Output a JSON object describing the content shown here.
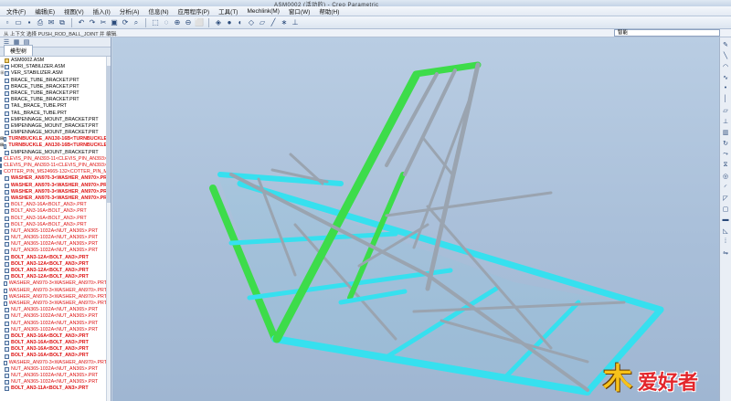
{
  "window": {
    "title": "ASM0002 (活动的) - Creo Parametric"
  },
  "menu": [
    "文件(F)",
    "编辑(E)",
    "视图(V)",
    "插入(I)",
    "分析(A)",
    "信息(N)",
    "应用程序(P)",
    "工具(T)",
    "Mechlink(M)",
    "窗口(W)",
    "帮助(H)"
  ],
  "toolbar": {
    "icons": [
      "new-icon",
      "open-icon",
      "save-icon",
      "print-icon",
      "email-icon",
      "copy-icon",
      "undo-icon",
      "redo-icon",
      "cut-icon",
      "paste-icon",
      "regenerate-icon",
      "find-icon",
      "select-icon",
      "repaint-icon",
      "zoom-in-icon",
      "zoom-out-icon",
      "refit-icon",
      "orient-icon",
      "shading-icon",
      "hidden-line-icon",
      "wireframe-icon",
      "datum-plane-icon",
      "datum-axis-icon",
      "datum-point-icon",
      "csys-icon"
    ]
  },
  "status": {
    "message": "从 上下文 选择 PUSH_ROD_BALL_JOINT 并 编辑.",
    "filter_value": "智能"
  },
  "model_tree": {
    "tab": "模型树",
    "items": [
      {
        "label": "ASM0002.ASM",
        "root": true
      },
      {
        "label": "HORI_STABILIZER.ASM",
        "exp": "+"
      },
      {
        "label": "VER_STABILIZER.ASM",
        "exp": "+"
      },
      {
        "label": "BRACE_TUBE_BRACKET.PRT"
      },
      {
        "label": "BRACE_TUBE_BRACKET.PRT"
      },
      {
        "label": "BRACE_TUBE_BRACKET.PRT"
      },
      {
        "label": "BRACE_TUBE_BRACKET.PRT"
      },
      {
        "label": "TAIL_BRACE_TUBE.PRT"
      },
      {
        "label": "TAIL_BRACE_TUBE.PRT"
      },
      {
        "label": "EMPENNAGE_MOUNT_BRACKET.PRT"
      },
      {
        "label": "EMPENNAGE_MOUNT_BRACKET.PRT"
      },
      {
        "label": "EMPENNAGE_MOUNT_BRACKET.PRT"
      },
      {
        "label": "TURNBUCKLE_AN130-16B<TURNBUCKLE",
        "exp": "+",
        "red": true,
        "bold": true
      },
      {
        "label": "TURNBUCKLE_AN130-16B<TURNBUCKLE",
        "exp": "+",
        "red": true,
        "bold": true
      },
      {
        "label": "EMPENNAGE_MOUNT_BRACKET.PRT"
      },
      {
        "label": "CLEVIS_PIN_AN393-11<CLEVIS_PIN_AN393>",
        "red": true
      },
      {
        "label": "CLEVIS_PIN_AN393-11<CLEVIS_PIN_AN393>",
        "red": true
      },
      {
        "label": "COTTER_PIN_MS24665-132<COTTER_PIN_M",
        "red": true
      },
      {
        "label": "WASHER_AN970-3<WASHER_AN970>.PR",
        "red": true,
        "bold": true
      },
      {
        "label": "WASHER_AN970-3<WASHER_AN970>.PR",
        "red": true,
        "bold": true
      },
      {
        "label": "WASHER_AN970-3<WASHER_AN970>.PR",
        "red": true,
        "bold": true
      },
      {
        "label": "WASHER_AN970-3<WASHER_AN970>.PR",
        "red": true,
        "bold": true
      },
      {
        "label": "BOLT_AN3-16A<BOLT_AN3>.PRT",
        "red": true
      },
      {
        "label": "BOLT_AN3-16A<BOLT_AN3>.PRT",
        "red": true
      },
      {
        "label": "BOLT_AN3-16A<BOLT_AN3>.PRT",
        "red": true
      },
      {
        "label": "BOLT_AN3-16A<BOLT_AN3>.PRT",
        "red": true
      },
      {
        "label": "NUT_AN365-1032A<NUT_AN365>.PRT",
        "red": true
      },
      {
        "label": "NUT_AN365-1032A<NUT_AN365>.PRT",
        "red": true
      },
      {
        "label": "NUT_AN365-1032A<NUT_AN365>.PRT",
        "red": true
      },
      {
        "label": "NUT_AN365-1032A<NUT_AN365>.PRT",
        "red": true
      },
      {
        "label": "BOLT_AN3-12A<BOLT_AN3>.PRT",
        "red": true,
        "bold": true
      },
      {
        "label": "BOLT_AN3-12A<BOLT_AN3>.PRT",
        "red": true,
        "bold": true
      },
      {
        "label": "BOLT_AN3-12A<BOLT_AN3>.PRT",
        "red": true,
        "bold": true
      },
      {
        "label": "BOLT_AN3-12A<BOLT_AN3>.PRT",
        "red": true,
        "bold": true
      },
      {
        "label": "WASHER_AN970-3<WASHER_AN970>.PRT",
        "red": true
      },
      {
        "label": "WASHER_AN970-3<WASHER_AN970>.PRT",
        "red": true
      },
      {
        "label": "WASHER_AN970-3<WASHER_AN970>.PRT",
        "red": true
      },
      {
        "label": "WASHER_AN970-3<WASHER_AN970>.PRT",
        "red": true
      },
      {
        "label": "NUT_AN365-1032A<NUT_AN365>.PRT",
        "red": true
      },
      {
        "label": "NUT_AN365-1032A<NUT_AN365>.PRT",
        "red": true
      },
      {
        "label": "NUT_AN365-1032A<NUT_AN365>.PRT",
        "red": true
      },
      {
        "label": "NUT_AN365-1032A<NUT_AN365>.PRT",
        "red": true
      },
      {
        "label": "BOLT_AN3-16A<BOLT_AN3>.PRT",
        "red": true,
        "bold": true
      },
      {
        "label": "BOLT_AN3-16A<BOLT_AN3>.PRT",
        "red": true,
        "bold": true
      },
      {
        "label": "BOLT_AN3-16A<BOLT_AN3>.PRT",
        "red": true,
        "bold": true
      },
      {
        "label": "BOLT_AN3-16A<BOLT_AN3>.PRT",
        "red": true,
        "bold": true
      },
      {
        "label": "WASHER_AN970-3<WASHER_AN970>.PRT",
        "red": true
      },
      {
        "label": "NUT_AN365-1032A<NUT_AN365>.PRT",
        "red": true
      },
      {
        "label": "NUT_AN365-1032A<NUT_AN365>.PRT",
        "red": true
      },
      {
        "label": "NUT_AN365-1032A<NUT_AN365>.PRT",
        "red": true
      },
      {
        "label": "BOLT_AN3-11A<BOLT_AN3>.PRT",
        "red": true,
        "bold": true
      }
    ]
  },
  "right_toolbar": {
    "icons": [
      "sketch-icon",
      "line-icon",
      "arc-icon",
      "spline-icon",
      "point-icon",
      "axis-icon",
      "plane-icon",
      "csys-icon",
      "extrude-icon",
      "revolve-icon",
      "sweep-icon",
      "blend-icon",
      "hole-icon",
      "round-icon",
      "chamfer-icon",
      "shell-icon",
      "rib-icon",
      "draft-icon",
      "pattern-icon",
      "mirror-icon"
    ]
  },
  "colors": {
    "tube_green": "#3ddc4a",
    "tube_cyan": "#36e0ef",
    "tube_gray": "#9aa4b0",
    "viewport_bg": "#adc3dc",
    "tree_red": "#d11111"
  },
  "watermark": {
    "text": "爱好者",
    "mark": "木"
  }
}
